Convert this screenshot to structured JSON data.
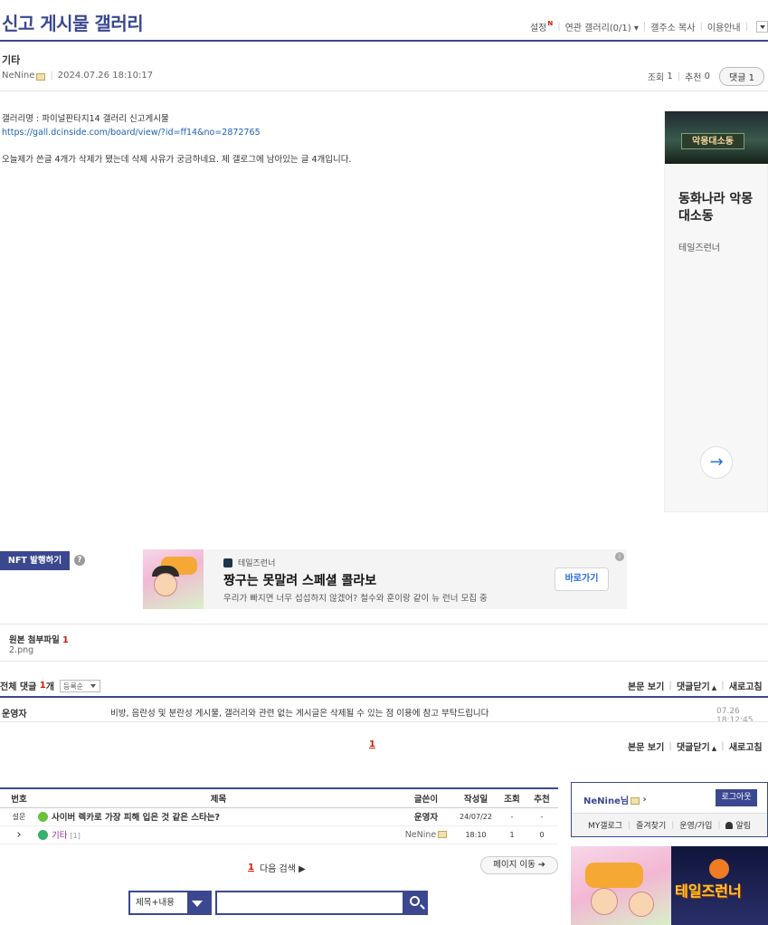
{
  "header": {
    "title": "신고 게시물 갤러리",
    "links": [
      "설정",
      "연관 갤러리(0/1)",
      "갤주소 복사",
      "이용안내"
    ],
    "new_badge": "N"
  },
  "post": {
    "category": "기타",
    "author": "NeNine",
    "datetime": "2024.07.26 18:10:17",
    "views_label": "조회",
    "views": "1",
    "recommend_label": "추천",
    "recommend": "0",
    "reply_label": "댓글",
    "reply_count": "1",
    "content": {
      "line1": "갤러리명 : 파이널판타지14 갤러리 신고게시물",
      "link": "https://gall.dcinside.com/board/view/?id=ff14&no=2872765",
      "line3": "오늘제가 쓴글 4개가 삭제가 됐는데 삭제 사유가 궁금하네요. 제 갤로그에 남아있는 글 4개입니다."
    }
  },
  "side_ad": {
    "title": "동화나라 악몽 대소동",
    "subtitle": "테일즈런너",
    "image_text": "악몽대소동",
    "arrow": "→"
  },
  "nft": {
    "button": "NFT 발행하기",
    "help": "?"
  },
  "banner_ad": {
    "brand": "테일즈런너",
    "title": "짱구는 못말려 스페셜 콜라보",
    "desc": "우리가 빠지면 너무 섭섭하지 않겠어? 철수와 훈이랑 같이 뉴 런너 모집 중",
    "cta": "바로가기",
    "info": "i"
  },
  "attachment": {
    "label": "원본 첨부파일",
    "count": "1",
    "file": "2.png"
  },
  "comments": {
    "total_label": "전체 댓글",
    "total": "1",
    "unit": "개",
    "sort": "등록순",
    "view_post": "본문 보기",
    "close_comments": "댓글닫기",
    "refresh": "새로고침",
    "items": [
      {
        "name": "운영자",
        "text": "비방, 음란성 및 분란성 게시물, 갤러리와 관련 없는 게시글은 삭제될 수 있는 점 이용에 참고 부탁드립니다",
        "date": "07.26 18:12:45"
      }
    ],
    "page": "1"
  },
  "list": {
    "headers": [
      "번호",
      "제목",
      "글쓴이",
      "작성일",
      "조회",
      "추천"
    ],
    "rows": [
      {
        "no": "설문",
        "title": "사이버 렉카로 가장 피해 입은 것 같은 스타는?",
        "comments": "",
        "author": "운영자",
        "date": "24/07/22",
        "views": "-",
        "rec": "-"
      },
      {
        "no": "›",
        "title": "기타",
        "comments": "[1]",
        "author": "NeNine",
        "date": "18:10",
        "views": "1",
        "rec": "0"
      }
    ],
    "page": "1",
    "next_search": "다음 검색 ▶",
    "page_move": "페이지 이동 ➔"
  },
  "search": {
    "type": "제목+내용",
    "placeholder": ""
  },
  "login": {
    "name": "NeNine님",
    "logout": "로그아웃",
    "menu": [
      "MY갤로그",
      "즐겨찾기",
      "운영/가입",
      "알림"
    ]
  },
  "bottom_ad": {
    "text": "테일즈런너"
  }
}
